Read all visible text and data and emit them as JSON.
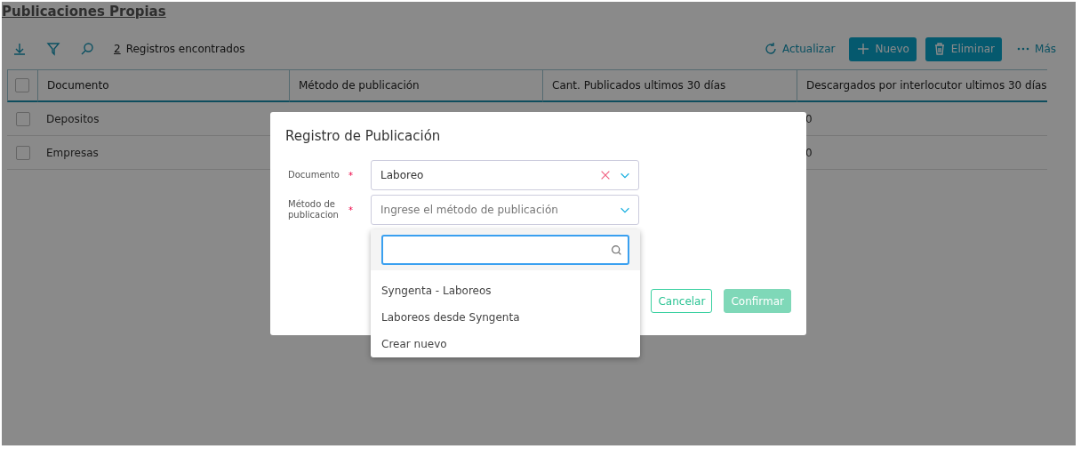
{
  "page": {
    "title": "Publicaciones Propias"
  },
  "toolbar": {
    "count": "2",
    "count_label": "Registros encontrados",
    "actions": [
      {
        "kind": "refresh",
        "label": "Actualizar"
      },
      {
        "kind": "new",
        "label": "Nuevo"
      },
      {
        "kind": "delete",
        "label": "Eliminar"
      },
      {
        "kind": "more",
        "label": "Más"
      }
    ]
  },
  "table": {
    "columns": [
      "Documento",
      "Método de publicación",
      "Cant. Publicados ultimos 30 días",
      "Descargados por interlocutor ultimos 30 días"
    ],
    "header_checked": false,
    "rows": [
      {
        "checked": false,
        "documento": "Depositos",
        "descargados": "0"
      },
      {
        "checked": false,
        "documento": "Empresas",
        "descargados": "0"
      }
    ]
  },
  "modal": {
    "title": "Registro de Publicación",
    "fields": [
      {
        "label": "Documento",
        "required_mark": "*",
        "value": "Laboreo",
        "clearable": true
      },
      {
        "label": "Método de publicacion",
        "required_mark": "*",
        "placeholder": "Ingrese el método de publicación",
        "clearable": false
      }
    ],
    "dropdown": {
      "options": [
        "Syngenta - Laboreos",
        "Laboreos desde Syngenta",
        "Crear nuevo"
      ]
    },
    "buttons": [
      {
        "kind": "secondary",
        "label": "Cancelar",
        "disabled": false
      },
      {
        "kind": "primary",
        "label": "Confirmar",
        "disabled": true
      }
    ]
  }
}
